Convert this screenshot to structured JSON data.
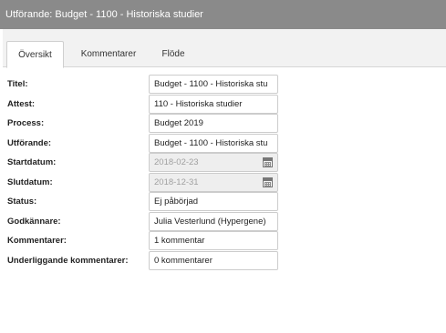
{
  "window": {
    "title": "Utförande: Budget - 1100 - Historiska studier"
  },
  "tabs": [
    {
      "label": "Översikt",
      "active": true
    },
    {
      "label": "Kommentarer",
      "active": false
    },
    {
      "label": "Flöde",
      "active": false
    }
  ],
  "form": {
    "titel": {
      "label": "Titel:",
      "value": "Budget - 1100 - Historiska stu"
    },
    "attest": {
      "label": "Attest:",
      "value": "110 - Historiska studier"
    },
    "process": {
      "label": "Process:",
      "value": "Budget 2019"
    },
    "utforande": {
      "label": "Utförande:",
      "value": "Budget - 1100 - Historiska stu"
    },
    "startdatum": {
      "label": "Startdatum:",
      "value": "2018-02-23",
      "icon": "calendar-icon"
    },
    "slutdatum": {
      "label": "Slutdatum:",
      "value": "2018-12-31",
      "icon": "calendar-icon"
    },
    "status": {
      "label": "Status:",
      "value": "Ej påbörjad"
    },
    "godkannare": {
      "label": "Godkännare:",
      "value": "Julia Vesterlund (Hypergene)"
    },
    "kommentarer": {
      "label": "Kommentarer:",
      "value": "1 kommentar"
    },
    "underliggande": {
      "label": "Underliggande kommentarer:",
      "value": "0 kommentarer"
    }
  },
  "colors": {
    "titlebar": "#8a8a8a",
    "tab_strip": "#f2f2f2",
    "disabled_field": "#eeeeee"
  }
}
